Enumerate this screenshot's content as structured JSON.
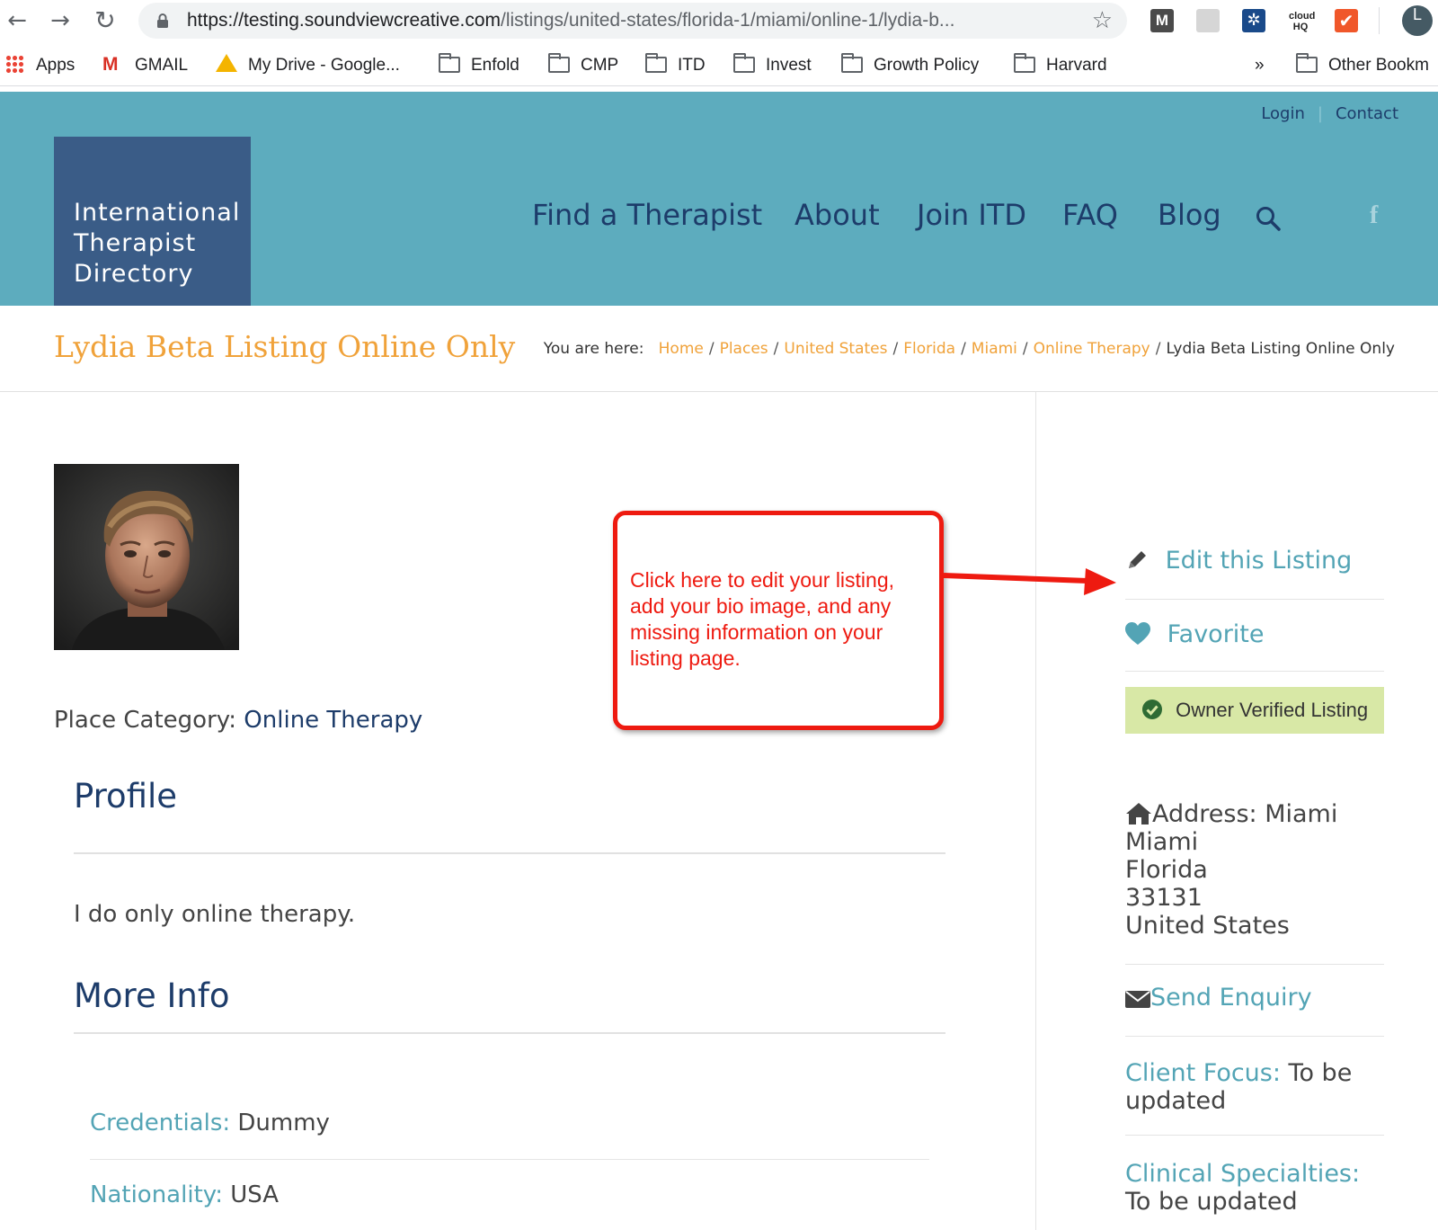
{
  "browser": {
    "url_host": "https://testing.soundviewcreative.com",
    "url_path": "/listings/united-states/florida-1/miami/online-1/lydia-b...",
    "profile_initial": "L",
    "extensions": [
      {
        "icon": "m-icon",
        "glyph": "M"
      },
      {
        "icon": "cast-icon",
        "glyph": ""
      },
      {
        "icon": "gear-icon",
        "glyph": "✲"
      },
      {
        "icon": "cloudhq-icon",
        "glyph": "cloud HQ"
      },
      {
        "icon": "check-icon",
        "glyph": "✔"
      }
    ]
  },
  "bookmarks": {
    "items": [
      "Apps",
      "GMAIL",
      "My Drive - Google...",
      "Enfold",
      "CMP",
      "ITD",
      "Invest",
      "Growth Policy",
      "Harvard"
    ],
    "overflow": "»",
    "other": "Other Bookm"
  },
  "header": {
    "top_links": {
      "login": "Login",
      "contact": "Contact"
    },
    "logo_lines": [
      "International",
      "Therapist",
      "Directory"
    ],
    "nav": [
      "Find a Therapist",
      "About",
      "Join ITD",
      "FAQ",
      "Blog"
    ],
    "facebook": "f"
  },
  "title_bar": {
    "title": "Lydia Beta Listing Online Only",
    "breadcrumb_label": "You are here:",
    "breadcrumb_links": [
      "Home",
      "Places",
      "United States",
      "Florida",
      "Miami",
      "Online Therapy"
    ],
    "breadcrumb_current": "Lydia Beta Listing Online Only"
  },
  "main": {
    "place_category_label": "Place Category:",
    "place_category_value": "Online Therapy",
    "profile_heading": "Profile",
    "profile_text": "I do only online therapy.",
    "more_info_heading": "More Info",
    "info": [
      {
        "label": "Credentials:",
        "value": " Dummy"
      },
      {
        "label": "Nationality:",
        "value": " USA"
      }
    ]
  },
  "callout": {
    "text": "Click here to edit your listing, add your bio image, and any missing information on your listing page.",
    "color": "#ee1a10"
  },
  "sidebar": {
    "edit_label": "Edit this Listing",
    "favorite_label": "Favorite",
    "verified_label": "Owner Verified Listing",
    "address_label": "Address:",
    "address_lines": [
      "Miami",
      "Miami",
      "Florida",
      "33131",
      "United States"
    ],
    "enquiry_label": "Send Enquiry",
    "client_focus_label": "Client Focus:",
    "client_focus_value": " To be updated",
    "clinical_label": "Clinical Specialties:",
    "clinical_value": " To be updated"
  },
  "colors": {
    "header_bg": "#5dacbe",
    "navy": "#1d3c6a",
    "orange": "#f0a23a",
    "teal_link": "#53a4b5",
    "verified_bg": "#d8e8a6"
  }
}
